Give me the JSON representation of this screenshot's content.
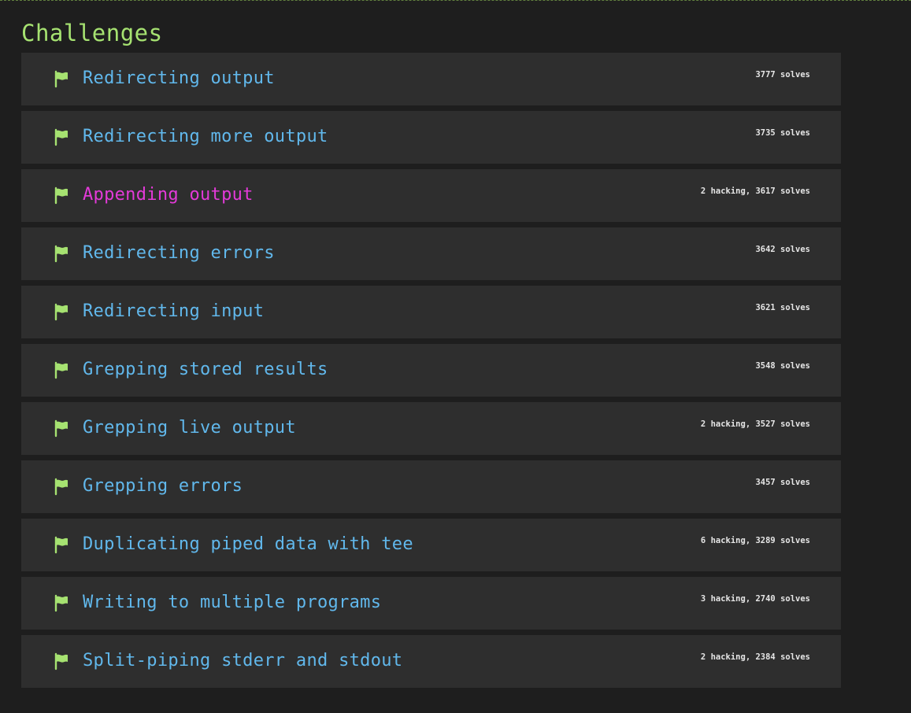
{
  "section": {
    "title": "Challenges"
  },
  "colors": {
    "background": "#1e1e1e",
    "row": "#2e2e2e",
    "heading": "#a6e271",
    "title": "#61b8ec",
    "title_active": "#e43ad9",
    "flag": "#a6e271",
    "stats": "#e6e6e6"
  },
  "challenges": [
    {
      "title": "Redirecting output",
      "stats": "3777 solves",
      "active": false,
      "icon": "flag-icon"
    },
    {
      "title": "Redirecting more output",
      "stats": "3735 solves",
      "active": false,
      "icon": "flag-icon"
    },
    {
      "title": "Appending output",
      "stats": "2 hacking, 3617 solves",
      "active": true,
      "icon": "flag-icon"
    },
    {
      "title": "Redirecting errors",
      "stats": "3642 solves",
      "active": false,
      "icon": "flag-icon"
    },
    {
      "title": "Redirecting input",
      "stats": "3621 solves",
      "active": false,
      "icon": "flag-icon"
    },
    {
      "title": "Grepping stored results",
      "stats": "3548 solves",
      "active": false,
      "icon": "flag-icon"
    },
    {
      "title": "Grepping live output",
      "stats": "2 hacking, 3527 solves",
      "active": false,
      "icon": "flag-icon"
    },
    {
      "title": "Grepping errors",
      "stats": "3457 solves",
      "active": false,
      "icon": "flag-icon"
    },
    {
      "title": "Duplicating piped data with tee",
      "stats": "6 hacking, 3289 solves",
      "active": false,
      "icon": "flag-icon"
    },
    {
      "title": "Writing to multiple programs",
      "stats": "3 hacking, 2740 solves",
      "active": false,
      "icon": "flag-icon"
    },
    {
      "title": "Split-piping stderr and stdout",
      "stats": "2 hacking, 2384 solves",
      "active": false,
      "icon": "flag-icon"
    }
  ]
}
